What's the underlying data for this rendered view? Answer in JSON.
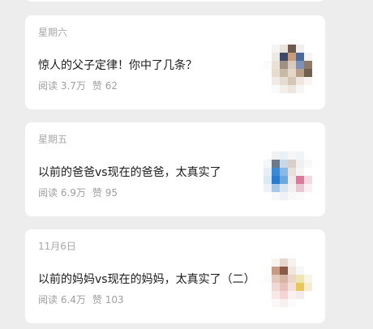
{
  "articles": [
    {
      "date": "星期六",
      "title": "惊人的父子定律！你中了几条？",
      "reads": "阅读 3.7万",
      "likes": "赞 62",
      "thumb_pixels": [
        "#ffffff",
        "#f4f4f2",
        "#e8e3dd",
        "#6e5a4c",
        "#f0eeee",
        "#ffffff",
        "#ffffff",
        "#efe9e4",
        "#3b4a66",
        "#c99c7c",
        "#4a6b9a",
        "#f5f5f5",
        "#fbfbfb",
        "#e9e0d6",
        "#a08f83",
        "#d9c9be",
        "#7d90b5",
        "#8f7a6a",
        "#ffffff",
        "#e7dccf",
        "#c8b8a8",
        "#e4d6c8",
        "#b8a08c",
        "#706050",
        "#ffffff",
        "#f0ebe6",
        "#e6dcd2",
        "#d6c6b6",
        "#efe7e0",
        "#f7f4f1",
        "#ffffff",
        "#fafafa",
        "#f2eeea",
        "#ece6e0",
        "#f8f6f4",
        "#ffffff"
      ]
    },
    {
      "date": "星期五",
      "title": "以前的爸爸vs现在的爸爸，太真实了",
      "reads": "阅读 6.9万",
      "likes": "赞 95",
      "thumb_pixels": [
        "#ffffff",
        "#f2f2f2",
        "#e8f0f8",
        "#f6f6f6",
        "#eef4f8",
        "#ffffff",
        "#f4f6f8",
        "#6a7a8a",
        "#c8d8e8",
        "#d8d0c8",
        "#f0f0f0",
        "#f8f8f8",
        "#e8eef4",
        "#3a8ad8",
        "#8ab8e8",
        "#e8e0d8",
        "#f4f4f4",
        "#ffffff",
        "#dce8f4",
        "#2a7ad0",
        "#6aa8e0",
        "#f0e8e8",
        "#d87a9a",
        "#f4d8e0",
        "#eef2f6",
        "#a8c8e8",
        "#d8e4f0",
        "#f4f0f0",
        "#e8c8d4",
        "#f8f0f2",
        "#ffffff",
        "#f6f8fa",
        "#eef2f6",
        "#f8f8f8",
        "#fafafa",
        "#ffffff"
      ]
    },
    {
      "date": "11月6日",
      "title": "以前的妈妈vs现在的妈妈，太真实了（二）",
      "reads": "阅读 6.4万",
      "likes": "赞 103",
      "thumb_pixels": [
        "#ffffff",
        "#f8f4f2",
        "#e8d6cc",
        "#f6f2f0",
        "#ffffff",
        "#ffffff",
        "#ffffff",
        "#c89a84",
        "#8a5a48",
        "#f0e6e0",
        "#f6f6f6",
        "#ffffff",
        "#fbfbfb",
        "#e4c8bc",
        "#d8b4a4",
        "#ecd6cc",
        "#f0e4b0",
        "#f8f4e8",
        "#ffffff",
        "#f0d8d4",
        "#e8c0bc",
        "#f4e0dc",
        "#e8c858",
        "#f6ecd0",
        "#ffffff",
        "#f8e8e8",
        "#f4d4d4",
        "#faf0ee",
        "#f4ecec",
        "#ffffff",
        "#ffffff",
        "#fcf8f8",
        "#f8f0f0",
        "#fcfafa",
        "#ffffff",
        "#ffffff"
      ]
    }
  ]
}
